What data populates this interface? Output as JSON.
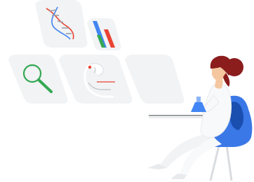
{
  "scene": {
    "panels": [
      {
        "id": "dna",
        "icon": "dna-helix-icon"
      },
      {
        "id": "chart",
        "icon": "bar-chart-icon"
      },
      {
        "id": "search",
        "icon": "magnifying-glass-icon"
      },
      {
        "id": "lab",
        "icon": "lab-specimen-icon"
      },
      {
        "id": "blank",
        "icon": ""
      }
    ],
    "figure": "scientist-seated-with-flask",
    "colors": {
      "panel": "#f1f3f4",
      "google_blue": "#4285f4",
      "google_green": "#34a853",
      "google_red": "#ea4335",
      "hair": "#8b1d1d",
      "chair": "#3b78e7",
      "chair_dark": "#1a4fb0",
      "coat": "#f8f9fa"
    }
  }
}
